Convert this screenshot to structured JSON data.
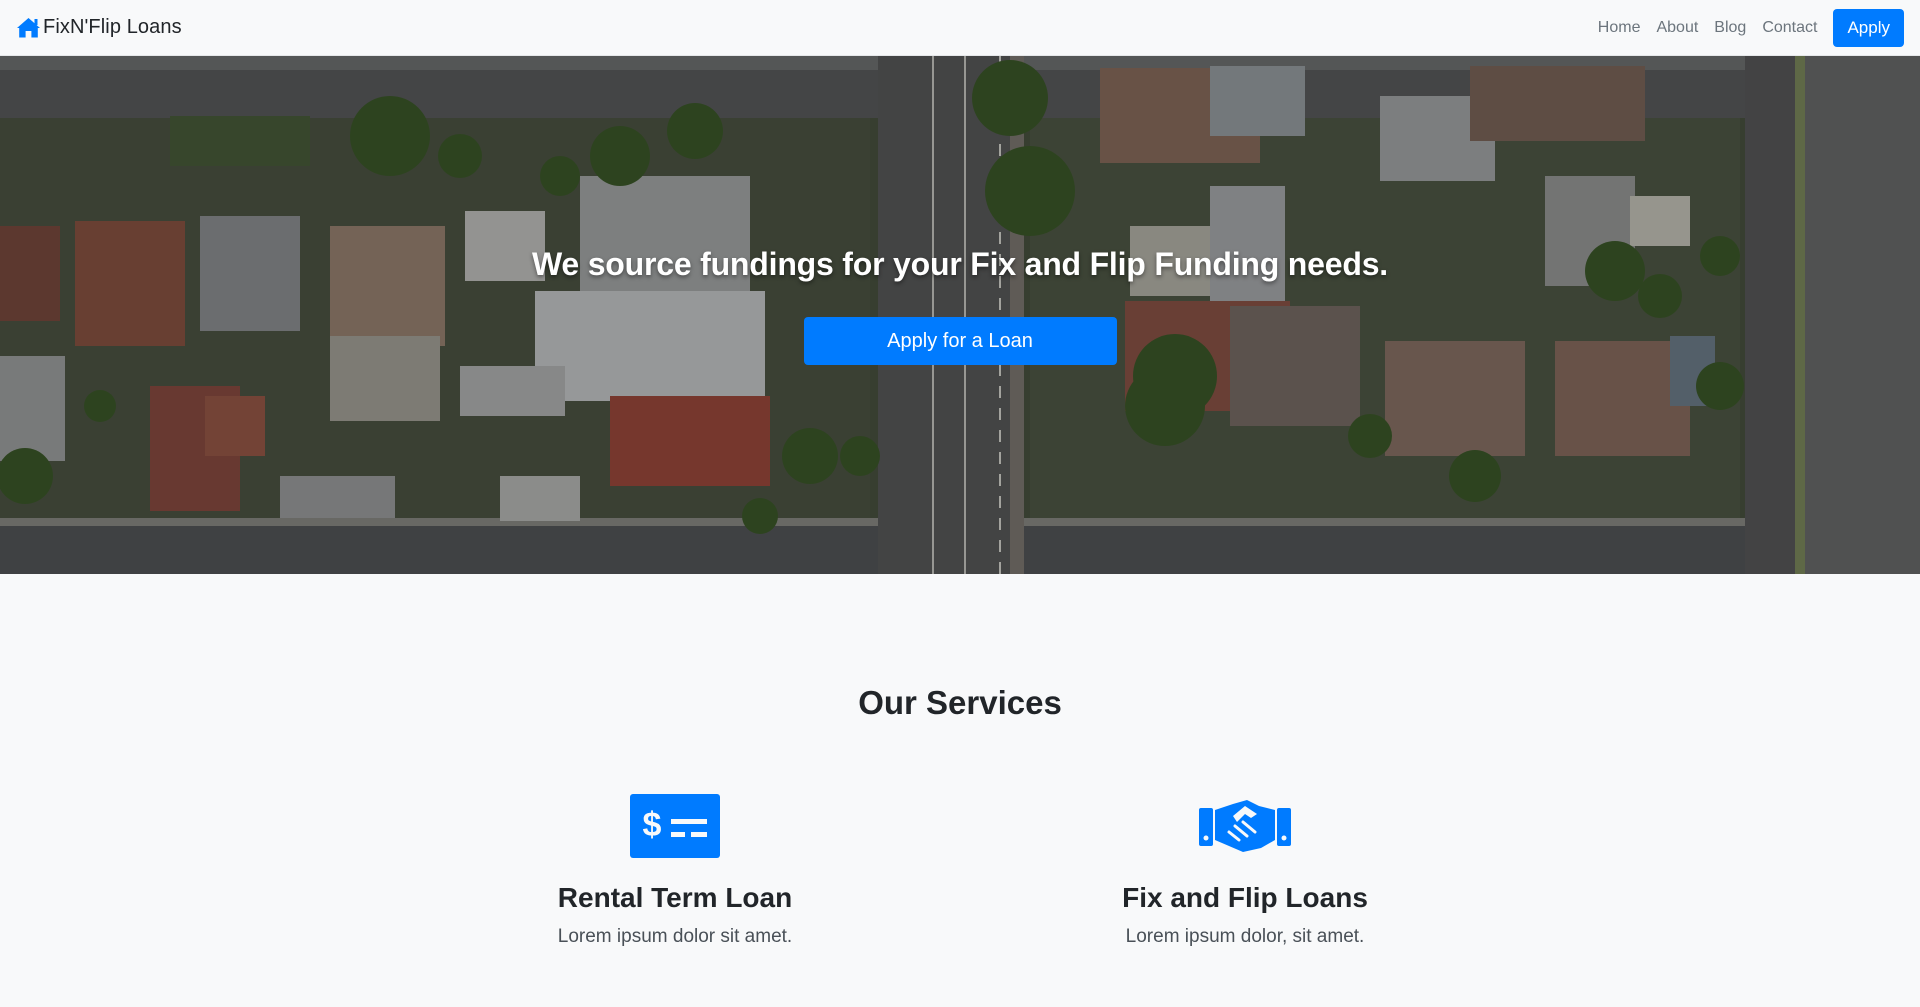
{
  "navbar": {
    "brand": "FixN'Flip Loans",
    "brand_icon": "home-icon",
    "links": [
      "Home",
      "About",
      "Blog",
      "Contact"
    ],
    "apply_label": "Apply"
  },
  "hero": {
    "title": "We source fundings for your Fix and Flip Funding needs.",
    "button_label": "Apply for a Loan",
    "background": "aerial-neighborhood-photo"
  },
  "services": {
    "title": "Our Services",
    "items": [
      {
        "icon": "money-check-icon",
        "title": "Rental Term Loan",
        "description": "Lorem ipsum dolor sit amet."
      },
      {
        "icon": "handshake-icon",
        "title": "Fix and Flip Loans",
        "description": "Lorem ipsum dolor, sit amet."
      }
    ]
  },
  "colors": {
    "primary": "#007bff",
    "background": "#f8f9fa",
    "text": "#212529",
    "muted": "#6c757d"
  }
}
